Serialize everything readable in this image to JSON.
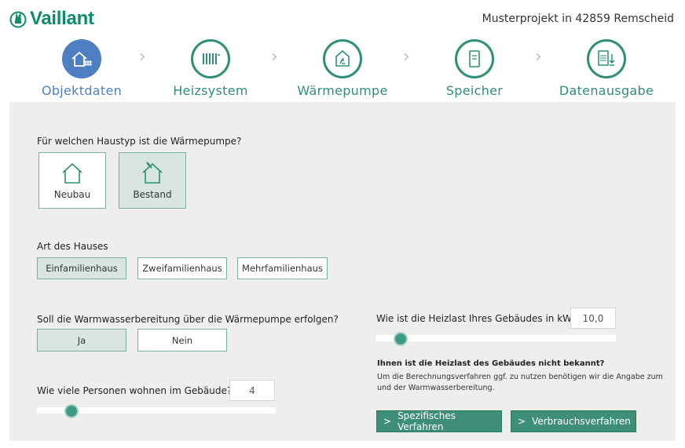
{
  "header": {
    "brand": "Vaillant",
    "project": "Musterprojekt in 42859 Remscheid"
  },
  "steps": [
    {
      "label": "Objektdaten",
      "icon": "house-icon",
      "active": true
    },
    {
      "label": "Heizsystem",
      "icon": "radiator-icon",
      "active": false
    },
    {
      "label": "Wärmepumpe",
      "icon": "heat-pump-icon",
      "active": false
    },
    {
      "label": "Speicher",
      "icon": "storage-tank-icon",
      "active": false
    },
    {
      "label": "Datenausgabe",
      "icon": "pdf-download-icon",
      "active": false
    }
  ],
  "colors": {
    "accent": "#2f8f77",
    "active_step": "#4f7fc3",
    "panel": "#eeeeed",
    "button": "#3f8f78"
  },
  "house_type": {
    "question": "Für welchen Haustyp ist die Wärmepumpe?",
    "options": [
      "Neubau",
      "Bestand"
    ],
    "selected": "Bestand"
  },
  "house_kind": {
    "question": "Art des Hauses",
    "options": [
      "Einfamilienhaus",
      "Zweifamilienhaus",
      "Mehrfamilienhaus"
    ],
    "selected": "Einfamilienhaus"
  },
  "hot_water": {
    "question": "Soll die Warmwasserbereitung über die Wärmepumpe erfolgen?",
    "options": [
      "Ja",
      "Nein"
    ],
    "selected": "Ja"
  },
  "persons": {
    "question": "Wie viele Personen wohnen im Gebäude?",
    "value": "4",
    "slider_fraction": 0.1
  },
  "heat_load": {
    "question": "Wie ist die Heizlast Ihres Gebäudes in kW?",
    "value": "10,0",
    "slider_fraction": 0.1
  },
  "unknown": {
    "title": "Ihnen ist die Heizlast des Gebäudes nicht bekannt?",
    "line1": "Um die Berechnungsverfahren ggf. zu nutzen benötigen wir die Angabe zum Gebäude",
    "line2": "und der Warmwasserbereitung."
  },
  "actions": {
    "specific": "Spezifisches Verfahren",
    "consumption": "Verbrauchsverfahren",
    "arrow": ">"
  },
  "chevron": "›"
}
